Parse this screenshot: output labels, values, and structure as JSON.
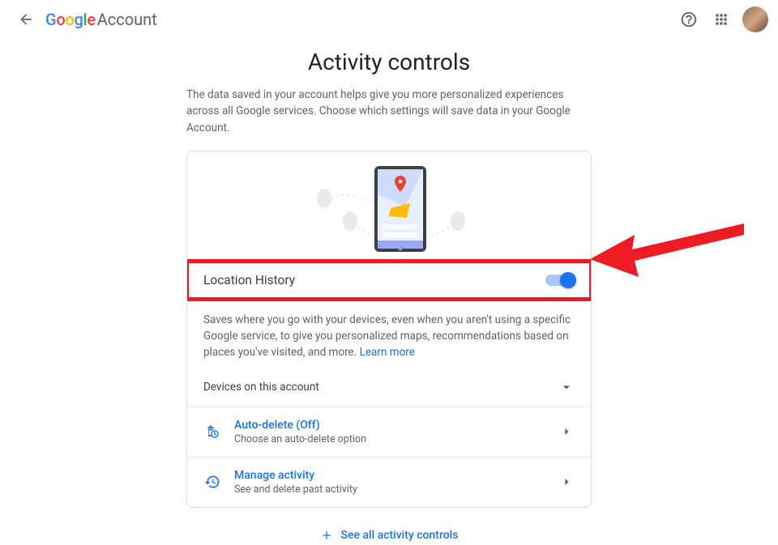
{
  "header": {
    "product": "Account",
    "logo": {
      "g": "G",
      "o1": "o",
      "o2": "o",
      "g2": "g",
      "l": "l",
      "e": "e"
    }
  },
  "page": {
    "title": "Activity controls",
    "subtitle": "The data saved in your account helps give you more personalized experiences across all Google services. Choose which settings will save data in your Google Account."
  },
  "card": {
    "toggle": {
      "label": "Location History",
      "on": true
    },
    "description": "Saves where you go with your devices, even when you aren't using a specific Google service, to give you personalized maps, recommendations based on places you've visited, and more.",
    "learn_more": "Learn more",
    "devices_label": "Devices on this account",
    "rows": [
      {
        "title": "Auto-delete (Off)",
        "subtitle": "Choose an auto-delete option"
      },
      {
        "title": "Manage activity",
        "subtitle": "See and delete past activity"
      }
    ]
  },
  "footer": {
    "see_all": "See all activity controls"
  },
  "annotation": {
    "highlight_color": "#ed1c24"
  }
}
